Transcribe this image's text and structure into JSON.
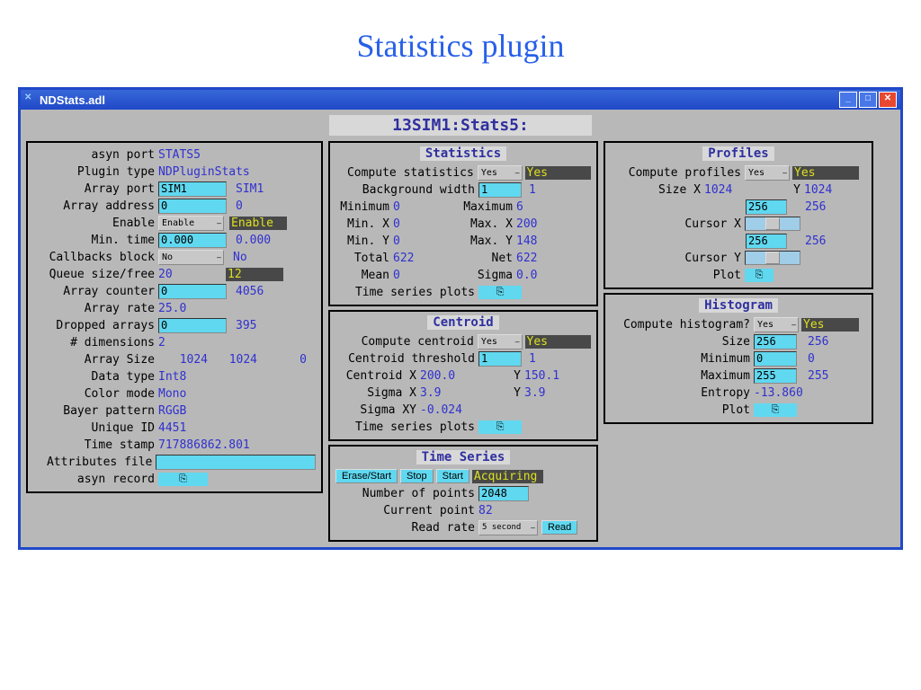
{
  "page_title": "Statistics plugin",
  "window_title": "NDStats.adl",
  "prefix": "13SIM1:Stats5:",
  "left": {
    "asyn_port_lbl": "asyn port",
    "asyn_port": "STATS5",
    "plugin_type_lbl": "Plugin type",
    "plugin_type": "NDPluginStats",
    "array_port_lbl": "Array port",
    "array_port_in": "SIM1",
    "array_port_rb": "SIM1",
    "array_addr_lbl": "Array address",
    "array_addr_in": "0",
    "array_addr_rb": "0",
    "enable_lbl": "Enable",
    "enable_dd": "Enable",
    "enable_rb": "Enable",
    "min_time_lbl": "Min. time",
    "min_time_in": "0.000",
    "min_time_rb": "0.000",
    "cb_block_lbl": "Callbacks block",
    "cb_block_dd": "No",
    "cb_block_rb": "No",
    "queue_lbl": "Queue size/free",
    "queue_size": "20",
    "queue_free": "12",
    "arr_ctr_lbl": "Array counter",
    "arr_ctr_in": "0",
    "arr_ctr_rb": "4056",
    "arr_rate_lbl": "Array rate",
    "arr_rate": "25.0",
    "dropped_lbl": "Dropped arrays",
    "dropped_in": "0",
    "dropped_rb": "395",
    "dims_lbl": "# dimensions",
    "dims": "2",
    "size_lbl": "Array Size",
    "size_x": "1024",
    "size_y": "1024",
    "size_z": "0",
    "dtype_lbl": "Data type",
    "dtype": "Int8",
    "cmode_lbl": "Color mode",
    "cmode": "Mono",
    "bayer_lbl": "Bayer pattern",
    "bayer": "RGGB",
    "uid_lbl": "Unique ID",
    "uid": "4451",
    "ts_lbl": "Time stamp",
    "ts": "717886862.801",
    "attr_lbl": "Attributes file",
    "asyn_rec_lbl": "asyn record"
  },
  "stats": {
    "title": "Statistics",
    "compute_lbl": "Compute statistics",
    "compute_dd": "Yes",
    "compute_rb": "Yes",
    "bgw_lbl": "Background width",
    "bgw_in": "1",
    "bgw_rb": "1",
    "min_lbl": "Minimum",
    "min": "0",
    "max_lbl": "Maximum",
    "max": "6",
    "minx_lbl": "Min. X",
    "minx": "0",
    "maxx_lbl": "Max. X",
    "maxx": "200",
    "miny_lbl": "Min. Y",
    "miny": "0",
    "maxy_lbl": "Max. Y",
    "maxy": "148",
    "total_lbl": "Total",
    "total": "622",
    "net_lbl": "Net",
    "net": "622",
    "mean_lbl": "Mean",
    "mean": "0",
    "sigma_lbl": "Sigma",
    "sigma": "0.0",
    "plots_lbl": "Time series plots"
  },
  "centroid": {
    "title": "Centroid",
    "compute_lbl": "Compute centroid",
    "compute_dd": "Yes",
    "compute_rb": "Yes",
    "thresh_lbl": "Centroid threshold",
    "thresh_in": "1",
    "thresh_rb": "1",
    "cx_lbl": "Centroid X",
    "cx": "200.0",
    "cy_lbl": "Y",
    "cy": "150.1",
    "sx_lbl": "Sigma X",
    "sx": "3.9",
    "sy_lbl": "Y",
    "sy": "3.9",
    "sxy_lbl": "Sigma XY",
    "sxy": "-0.024",
    "plots_lbl": "Time series plots"
  },
  "ts": {
    "title": "Time Series",
    "erase": "Erase/Start",
    "stop": "Stop",
    "start": "Start",
    "status": "Acquiring",
    "npts_lbl": "Number of points",
    "npts": "2048",
    "cpt_lbl": "Current point",
    "cpt": "82",
    "rate_lbl": "Read rate",
    "rate_dd": "5 second",
    "read": "Read"
  },
  "profiles": {
    "title": "Profiles",
    "compute_lbl": "Compute profiles",
    "compute_dd": "Yes",
    "compute_rb": "Yes",
    "sizex_lbl": "Size X",
    "sizex": "1024",
    "sizey_lbl": "Y",
    "sizey": "1024",
    "curx_lbl": "Cursor X",
    "curx_in": "256",
    "curx_rb": "256",
    "cury_lbl": "Cursor Y",
    "cury_in": "256",
    "cury_rb": "256",
    "plot_lbl": "Plot"
  },
  "hist": {
    "title": "Histogram",
    "compute_lbl": "Compute histogram?",
    "compute_dd": "Yes",
    "compute_rb": "Yes",
    "size_lbl": "Size",
    "size_in": "256",
    "size_rb": "256",
    "min_lbl": "Minimum",
    "min_in": "0",
    "min_rb": "0",
    "max_lbl": "Maximum",
    "max_in": "255",
    "max_rb": "255",
    "ent_lbl": "Entropy",
    "ent": "-13.860",
    "plot_lbl": "Plot"
  }
}
